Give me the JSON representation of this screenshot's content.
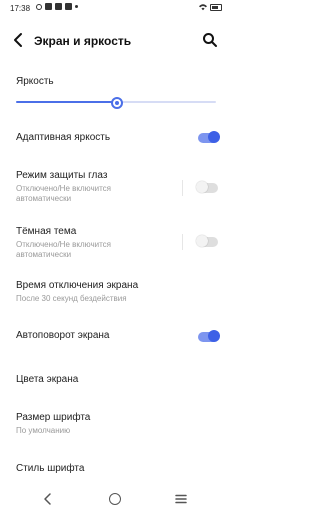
{
  "status_bar": {
    "time": "17:38"
  },
  "header": {
    "title": "Экран и яркость"
  },
  "brightness": {
    "label": "Яркость",
    "value": 0.5
  },
  "items": [
    {
      "id": "adaptive",
      "title": "Адаптивная яркость",
      "toggle": "on"
    },
    {
      "id": "eye",
      "title": "Режим защиты глаз",
      "subtitle": "Отключено/Не включится автоматически",
      "toggle": "off"
    },
    {
      "id": "dark",
      "title": "Тёмная тема",
      "subtitle": "Отключено/Не включится автоматически",
      "toggle": "off"
    },
    {
      "id": "timeout",
      "title": "Время отключения экрана",
      "subtitle": "После 30 секунд бездействия"
    },
    {
      "id": "autorotate",
      "title": "Автоповорот экрана",
      "toggle": "on"
    },
    {
      "id": "colors",
      "title": "Цвета экрана"
    },
    {
      "id": "fontsize",
      "title": "Размер шрифта",
      "subtitle": "По умолчанию"
    },
    {
      "id": "fontstyle",
      "title": "Стиль шрифта"
    }
  ],
  "colors": {
    "accent": "#3d60e6",
    "accent_light": "#7d95ef"
  }
}
